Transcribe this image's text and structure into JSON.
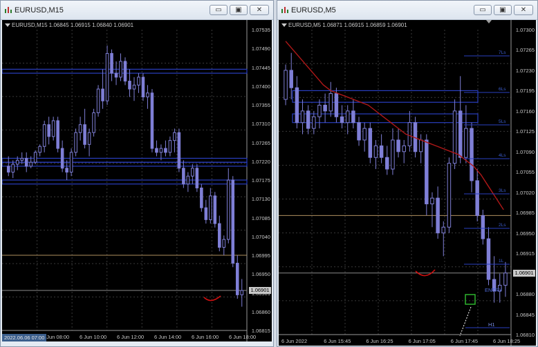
{
  "left_window": {
    "title": "EURUSD,M15",
    "header": "EURUSD,M15  1.06845 1.06915 1.06840 1.06901",
    "price_labels": [
      "1.07535",
      "1.07490",
      "1.07445",
      "1.07400",
      "1.07355",
      "1.07310",
      "1.07265",
      "1.07220",
      "1.07175",
      "1.07130",
      "1.07085",
      "1.07040",
      "1.06995",
      "1.06950",
      "1.06901",
      "1.06860",
      "1.06815"
    ],
    "time_labels": [
      "2022.06.06 07:00",
      "6 Jun 08:00",
      "6 Jun 10:00",
      "6 Jun 12:00",
      "6 Jun 14:00",
      "6 Jun 16:00",
      "6 Jun 18:00"
    ],
    "current_price": "1.06901",
    "cursor_time": "2022.06.06 07:00"
  },
  "right_window": {
    "title": "EURUSD,M5",
    "header": "EURUSD,M5  1.06871 1.06915 1.06859 1.06901",
    "price_labels": [
      "1.07300",
      "1.07265",
      "1.07230",
      "1.07195",
      "1.07160",
      "1.07125",
      "1.07090",
      "1.07055",
      "1.07020",
      "1.06985",
      "1.06950",
      "1.06915",
      "1.06901",
      "1.06880",
      "1.06845",
      "1.06810"
    ],
    "time_labels": [
      "6 Jun 2022",
      "6 Jun 15:45",
      "6 Jun 16:25",
      "6 Jun 17:05",
      "6 Jun 17:45",
      "6 Jun 18:25"
    ],
    "current_price": "1.06901",
    "levels": [
      "7Ls",
      "6Ls",
      "5Ls",
      "4Ls",
      "3Ls",
      "2Ls",
      "1L"
    ],
    "entry_label": "ENTRY",
    "h1_label": "H1"
  },
  "window_buttons": {
    "minimize": "▭",
    "maximize": "▣",
    "close": "✕"
  },
  "chart_data": [
    {
      "type": "candlestick",
      "title": "EURUSD,M15",
      "ylim": [
        1.068,
        1.0756
      ],
      "series_color": "#7f7fd6",
      "candles": [
        [
          1.07215,
          1.0724,
          1.0719,
          1.072
        ],
        [
          1.072,
          1.0723,
          1.07185,
          1.0722
        ],
        [
          1.0722,
          1.0724,
          1.07205,
          1.0723
        ],
        [
          1.0723,
          1.0725,
          1.0722,
          1.07235
        ],
        [
          1.07235,
          1.0725,
          1.072,
          1.07215
        ],
        [
          1.07215,
          1.0724,
          1.0721,
          1.07225
        ],
        [
          1.07225,
          1.07255,
          1.0722,
          1.0725
        ],
        [
          1.0725,
          1.0727,
          1.0724,
          1.07265
        ],
        [
          1.07265,
          1.0733,
          1.0725,
          1.0732
        ],
        [
          1.0732,
          1.0734,
          1.0727,
          1.0729
        ],
        [
          1.0729,
          1.0734,
          1.0728,
          1.0733
        ],
        [
          1.0733,
          1.0734,
          1.0725,
          1.0726
        ],
        [
          1.0726,
          1.0728,
          1.072,
          1.0721
        ],
        [
          1.0721,
          1.0723,
          1.0718,
          1.072
        ],
        [
          1.072,
          1.0726,
          1.0719,
          1.0725
        ],
        [
          1.0725,
          1.0731,
          1.0724,
          1.073
        ],
        [
          1.073,
          1.0734,
          1.0728,
          1.0732
        ],
        [
          1.0732,
          1.0736,
          1.0726,
          1.0727
        ],
        [
          1.0727,
          1.0731,
          1.0724,
          1.073
        ],
        [
          1.073,
          1.0736,
          1.0729,
          1.0735
        ],
        [
          1.0735,
          1.0742,
          1.0734,
          1.0741
        ],
        [
          1.0741,
          1.0746,
          1.0736,
          1.0738
        ],
        [
          1.0738,
          1.0752,
          1.0737,
          1.075
        ],
        [
          1.075,
          1.0751,
          1.0743,
          1.0745
        ],
        [
          1.0745,
          1.0748,
          1.0742,
          1.0744
        ],
        [
          1.0744,
          1.075,
          1.0743,
          1.0748
        ],
        [
          1.0748,
          1.0749,
          1.0742,
          1.0743
        ],
        [
          1.0743,
          1.0746,
          1.0739,
          1.0741
        ],
        [
          1.0741,
          1.0744,
          1.0738,
          1.0742
        ],
        [
          1.0742,
          1.0745,
          1.074,
          1.0744
        ],
        [
          1.0744,
          1.0745,
          1.0738,
          1.0739
        ],
        [
          1.0739,
          1.0742,
          1.0736,
          1.074
        ],
        [
          1.074,
          1.0741,
          1.0725,
          1.0726
        ],
        [
          1.0726,
          1.0728,
          1.0724,
          1.0725
        ],
        [
          1.0725,
          1.0727,
          1.0723,
          1.0726
        ],
        [
          1.0726,
          1.0728,
          1.0724,
          1.0725
        ],
        [
          1.0725,
          1.0729,
          1.0724,
          1.0728
        ],
        [
          1.0728,
          1.0731,
          1.0725,
          1.073
        ],
        [
          1.073,
          1.0731,
          1.072,
          1.0721
        ],
        [
          1.0721,
          1.0723,
          1.0716,
          1.0717
        ],
        [
          1.0717,
          1.072,
          1.0715,
          1.0719
        ],
        [
          1.0719,
          1.0722,
          1.0717,
          1.0721
        ],
        [
          1.0721,
          1.0722,
          1.0715,
          1.0716
        ],
        [
          1.0716,
          1.0717,
          1.071,
          1.0711
        ],
        [
          1.0711,
          1.0713,
          1.0707,
          1.0708
        ],
        [
          1.0708,
          1.0716,
          1.0707,
          1.0714
        ],
        [
          1.0714,
          1.0715,
          1.0706,
          1.0707
        ],
        [
          1.0707,
          1.0709,
          1.07,
          1.0701
        ],
        [
          1.0701,
          1.0704,
          1.0699,
          1.0703
        ],
        [
          1.0703,
          1.0721,
          1.0702,
          1.0718
        ],
        [
          1.0718,
          1.0719,
          1.0696,
          1.0697
        ],
        [
          1.0697,
          1.0699,
          1.0688,
          1.0689
        ],
        [
          1.0689,
          1.0693,
          1.0686,
          1.06901
        ]
      ],
      "hlines": [
        {
          "price": 1.0699,
          "color": "#b09060"
        },
        {
          "price": 1.06901,
          "color": "#8a8a8a"
        }
      ],
      "zones": [
        {
          "p1": 1.0746,
          "p2": 1.0745,
          "color": "#2a3fc0"
        },
        {
          "p1": 1.07235,
          "p2": 1.07225,
          "color": "#2a3fc0"
        },
        {
          "p1": 1.07225,
          "p2": 1.07215,
          "color": "#2a3fc0"
        },
        {
          "p1": 1.0718,
          "p2": 1.0717,
          "color": "#2a3fc0"
        }
      ]
    },
    {
      "type": "candlestick",
      "title": "EURUSD,M5",
      "ylim": [
        1.06795,
        1.0732
      ],
      "series_color": "#7f7fd6",
      "candles": [
        [
          1.072,
          1.0726,
          1.0719,
          1.0725
        ],
        [
          1.0725,
          1.0728,
          1.072,
          1.0722
        ],
        [
          1.0722,
          1.0724,
          1.0715,
          1.0716
        ],
        [
          1.0716,
          1.072,
          1.0714,
          1.0718
        ],
        [
          1.0718,
          1.0719,
          1.0714,
          1.0715
        ],
        [
          1.0715,
          1.0718,
          1.0714,
          1.0717
        ],
        [
          1.0717,
          1.072,
          1.0715,
          1.0719
        ],
        [
          1.0719,
          1.0721,
          1.0716,
          1.0718
        ],
        [
          1.0718,
          1.0723,
          1.0717,
          1.0721
        ],
        [
          1.0721,
          1.0722,
          1.0716,
          1.0717
        ],
        [
          1.0717,
          1.0719,
          1.0715,
          1.0716
        ],
        [
          1.0716,
          1.0719,
          1.0714,
          1.0718
        ],
        [
          1.0718,
          1.072,
          1.0715,
          1.0716
        ],
        [
          1.0716,
          1.0717,
          1.0712,
          1.0713
        ],
        [
          1.0713,
          1.0716,
          1.0711,
          1.0715
        ],
        [
          1.0715,
          1.0716,
          1.0709,
          1.071
        ],
        [
          1.071,
          1.0713,
          1.0708,
          1.0712
        ],
        [
          1.0712,
          1.0714,
          1.0709,
          1.071
        ],
        [
          1.071,
          1.0712,
          1.0707,
          1.0708
        ],
        [
          1.0708,
          1.0715,
          1.0707,
          1.0713
        ],
        [
          1.0713,
          1.0715,
          1.071,
          1.0711
        ],
        [
          1.0711,
          1.0713,
          1.0709,
          1.0712
        ],
        [
          1.0712,
          1.0718,
          1.0711,
          1.0716
        ],
        [
          1.0716,
          1.0717,
          1.071,
          1.0711
        ],
        [
          1.0711,
          1.0714,
          1.0709,
          1.0713
        ],
        [
          1.0713,
          1.0714,
          1.07,
          1.0702
        ],
        [
          1.0702,
          1.0704,
          1.0698,
          1.0703
        ],
        [
          1.0703,
          1.0705,
          1.0696,
          1.0697
        ],
        [
          1.0697,
          1.0699,
          1.0693,
          1.0698
        ],
        [
          1.0698,
          1.071,
          1.0697,
          1.0709
        ],
        [
          1.0709,
          1.072,
          1.0708,
          1.0718
        ],
        [
          1.0718,
          1.0724,
          1.0709,
          1.071
        ],
        [
          1.071,
          1.0719,
          1.0709,
          1.0715
        ],
        [
          1.0715,
          1.0716,
          1.0704,
          1.0706
        ],
        [
          1.0706,
          1.0708,
          1.0699,
          1.07
        ],
        [
          1.07,
          1.0701,
          1.0695,
          1.0696
        ],
        [
          1.0696,
          1.0698,
          1.0688,
          1.0689
        ],
        [
          1.0689,
          1.0693,
          1.0685,
          1.0687
        ],
        [
          1.0687,
          1.069,
          1.0685,
          1.0688
        ],
        [
          1.0688,
          1.0692,
          1.0686,
          1.06901
        ]
      ],
      "ma": [
        1.073,
        1.07285,
        1.0727,
        1.07255,
        1.0724,
        1.07225,
        1.07215,
        1.0721,
        1.07205,
        1.072,
        1.07195,
        1.0719,
        1.0718,
        1.0717,
        1.0716,
        1.0715,
        1.0714,
        1.07135,
        1.0713,
        1.07125,
        1.0712,
        1.07115,
        1.0711,
        1.07105,
        1.07095,
        1.07085,
        1.0707,
        1.0705,
        1.0703,
        1.0701
      ],
      "hlines": [
        {
          "price": 1.07,
          "color": "#b09060"
        },
        {
          "price": 1.06901,
          "color": "#8a8a8a"
        }
      ],
      "zones": [
        {
          "p1": 1.07215,
          "p2": 1.07195,
          "color": "#2a3fc0"
        },
        {
          "p1": 1.07175,
          "p2": 1.0716,
          "color": "#2a3fc0"
        }
      ]
    }
  ]
}
